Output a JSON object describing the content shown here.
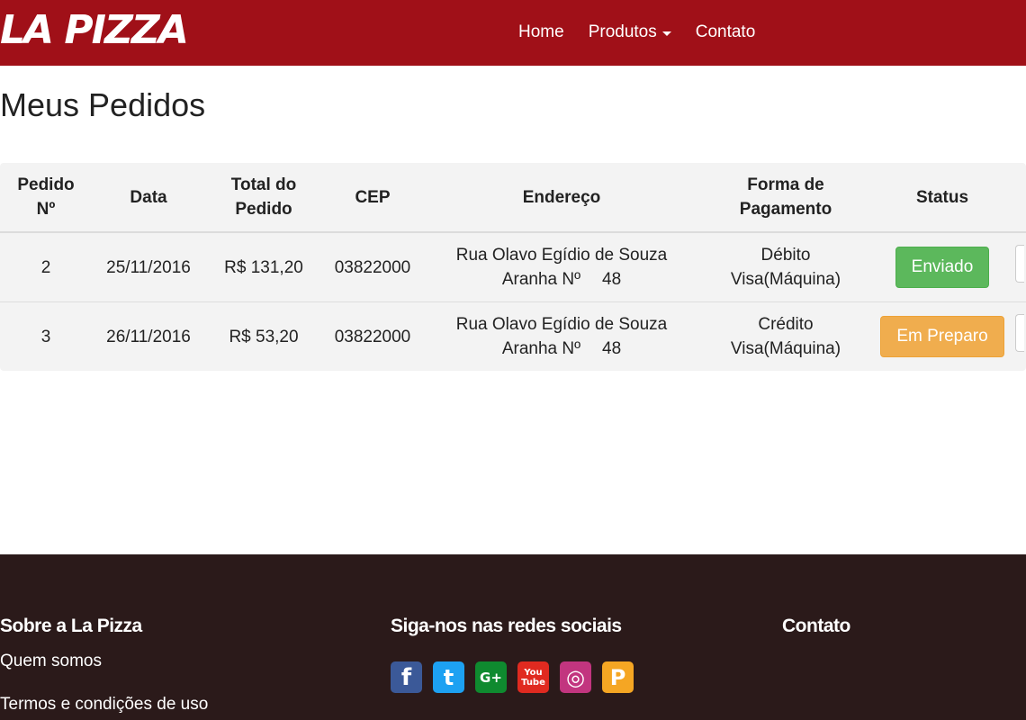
{
  "navbar": {
    "brand": "LA PIZZA",
    "links": {
      "home": "Home",
      "produtos": "Produtos",
      "contato": "Contato"
    }
  },
  "page": {
    "title": "Meus Pedidos"
  },
  "table": {
    "headers": {
      "pedido_l1": "Pedido",
      "pedido_l2": "Nº",
      "data": "Data",
      "total_l1": "Total do",
      "total_l2": "Pedido",
      "cep": "CEP",
      "endereco": "Endereço",
      "forma_l1": "Forma de",
      "forma_l2": "Pagamento",
      "status": "Status"
    },
    "rows": [
      {
        "pedido": "2",
        "data": "25/11/2016",
        "total": "R$ 131,20",
        "cep": "03822000",
        "endereco_l1": "Rua Olavo Egídio de Souza",
        "endereco_l2": "Aranha Nº",
        "numero": "48",
        "forma_l1": "Débito",
        "forma_l2": "Visa(Máquina)",
        "status": "Enviado",
        "status_color": "#5cb85c"
      },
      {
        "pedido": "3",
        "data": "26/11/2016",
        "total": "R$ 53,20",
        "cep": "03822000",
        "endereco_l1": "Rua Olavo Egídio de Souza",
        "endereco_l2": "Aranha Nº",
        "numero": "48",
        "forma_l1": "Crédito",
        "forma_l2": "Visa(Máquina)",
        "status": "Em Preparo",
        "status_color": "#f0ad4e"
      }
    ]
  },
  "footer": {
    "sobre": {
      "title": "Sobre a La Pizza",
      "link1": "Quem somos",
      "link2": "Termos e condições de uso"
    },
    "social": {
      "title": "Siga-nos nas redes sociais",
      "icons": [
        {
          "name": "facebook-icon",
          "glyph": "f",
          "color": "#3b5998"
        },
        {
          "name": "twitter-icon",
          "glyph": "t",
          "color": "#1da1f2"
        },
        {
          "name": "google-plus-icon",
          "glyph": "G+",
          "color": "#0f8a2f"
        },
        {
          "name": "youtube-icon",
          "glyph": "You Tube",
          "color": "#e02a20"
        },
        {
          "name": "instagram-icon",
          "glyph": "◎",
          "color": "#c2357f"
        },
        {
          "name": "pinterest-icon",
          "glyph": "P",
          "color": "#f5a623"
        }
      ]
    },
    "contato": {
      "title": "Contato"
    }
  },
  "colors": {
    "navbar": "#a01018",
    "footer": "#2b1a1a",
    "table_bg": "#f3f3f3"
  }
}
